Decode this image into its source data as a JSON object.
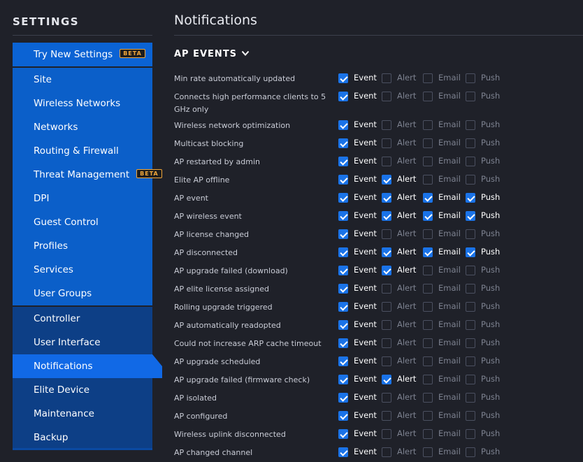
{
  "sidebar": {
    "title": "SETTINGS",
    "beta_badge": "BETA",
    "try_new": "Try New Settings",
    "site_items": [
      "Site",
      "Wireless Networks",
      "Networks",
      "Routing & Firewall",
      "Threat Management",
      "DPI",
      "Guest Control",
      "Profiles",
      "Services",
      "User Groups"
    ],
    "controller_items": [
      "Controller",
      "User Interface",
      "Notifications",
      "Elite Device",
      "Maintenance",
      "Backup"
    ],
    "active": "Notifications"
  },
  "main": {
    "title": "Notifications",
    "section": "AP EVENTS",
    "option_labels": [
      "Event",
      "Alert",
      "Email",
      "Push"
    ],
    "rows": [
      {
        "label": "Min rate automatically updated",
        "checked": [
          true,
          false,
          false,
          false
        ]
      },
      {
        "label": "Connects high performance clients to 5 GHz only",
        "checked": [
          true,
          false,
          false,
          false
        ]
      },
      {
        "label": "Wireless network optimization",
        "checked": [
          true,
          false,
          false,
          false
        ]
      },
      {
        "label": "Multicast blocking",
        "checked": [
          true,
          false,
          false,
          false
        ]
      },
      {
        "label": "AP restarted by admin",
        "checked": [
          true,
          false,
          false,
          false
        ]
      },
      {
        "label": "Elite AP offline",
        "checked": [
          true,
          true,
          false,
          false
        ]
      },
      {
        "label": "AP event",
        "checked": [
          true,
          true,
          true,
          true
        ]
      },
      {
        "label": "AP wireless event",
        "checked": [
          true,
          true,
          true,
          true
        ]
      },
      {
        "label": "AP license changed",
        "checked": [
          true,
          false,
          false,
          false
        ]
      },
      {
        "label": "AP disconnected",
        "checked": [
          true,
          true,
          true,
          true
        ]
      },
      {
        "label": "AP upgrade failed (download)",
        "checked": [
          true,
          true,
          false,
          false
        ]
      },
      {
        "label": "AP elite license assigned",
        "checked": [
          true,
          false,
          false,
          false
        ]
      },
      {
        "label": "Rolling upgrade triggered",
        "checked": [
          true,
          false,
          false,
          false
        ]
      },
      {
        "label": "AP automatically readopted",
        "checked": [
          true,
          false,
          false,
          false
        ]
      },
      {
        "label": "Could not increase ARP cache timeout",
        "checked": [
          true,
          false,
          false,
          false
        ]
      },
      {
        "label": "AP upgrade scheduled",
        "checked": [
          true,
          false,
          false,
          false
        ]
      },
      {
        "label": "AP upgrade failed (firmware check)",
        "checked": [
          true,
          true,
          false,
          false
        ]
      },
      {
        "label": "AP isolated",
        "checked": [
          true,
          false,
          false,
          false
        ]
      },
      {
        "label": "AP configured",
        "checked": [
          true,
          false,
          false,
          false
        ]
      },
      {
        "label": "Wireless uplink disconnected",
        "checked": [
          true,
          false,
          false,
          false
        ]
      },
      {
        "label": "AP changed channel",
        "checked": [
          true,
          false,
          false,
          false
        ]
      }
    ]
  }
}
